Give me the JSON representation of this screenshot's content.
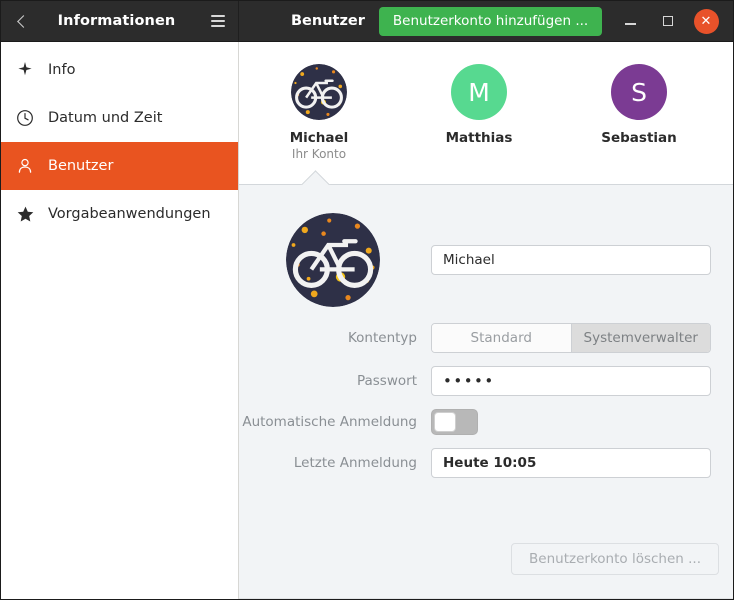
{
  "window": {
    "sidebar_title": "Informationen",
    "content_title": "Benutzer",
    "add_account_label": "Benutzerkonto hinzufügen ...",
    "back_icon": "back-chevron-icon",
    "menu_icon": "hamburger-menu-icon",
    "minimize_icon": "minimize-icon",
    "maximize_icon": "maximize-icon",
    "close_icon": "close-icon",
    "close_glyph": "✕",
    "accent_color": "#e95420",
    "add_button_color": "#3eb34f",
    "titlebar_color": "#2c2c2c"
  },
  "sidebar": {
    "items": [
      {
        "label": "Info",
        "icon": "sparkle-icon",
        "active": false
      },
      {
        "label": "Datum und Zeit",
        "icon": "clock-icon",
        "active": false
      },
      {
        "label": "Benutzer",
        "icon": "person-icon",
        "active": true
      },
      {
        "label": "Vorgabeanwendungen",
        "icon": "star-icon",
        "active": false
      }
    ]
  },
  "users": [
    {
      "name": "Michael",
      "subtitle": "Ihr Konto",
      "avatar_type": "photo",
      "avatar_photo": "bicycle-avatar",
      "selected": true
    },
    {
      "name": "Matthias",
      "subtitle": "",
      "avatar_type": "initial",
      "initial": "M",
      "color": "#57d990",
      "selected": false
    },
    {
      "name": "Sebastian",
      "subtitle": "",
      "avatar_type": "initial",
      "initial": "S",
      "color": "#7b3b93",
      "selected": false
    }
  ],
  "detail": {
    "avatar_photo": "bicycle-avatar",
    "name_value": "Michael",
    "account_type": {
      "label": "Kontentyp",
      "options": [
        "Standard",
        "Systemverwalter"
      ],
      "selected": "Systemverwalter"
    },
    "password": {
      "label": "Passwort",
      "value": "•••••"
    },
    "auto_login": {
      "label": "Automatische Anmeldung",
      "enabled": false
    },
    "last_login": {
      "label": "Letzte Anmeldung",
      "value": "Heute 10:05"
    },
    "delete_label": "Benutzerkonto löschen ..."
  }
}
